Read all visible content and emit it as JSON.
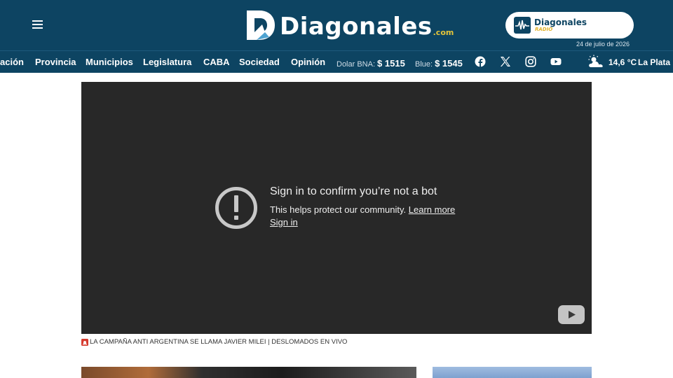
{
  "header": {
    "logo_text": "Diagonales",
    "logo_suffix": ".com",
    "radio_name": "Diagonales",
    "radio_sub": "RADIO",
    "date": "24 de julio de 2026"
  },
  "nav": {
    "items": [
      "ación",
      "Provincia",
      "Municipios",
      "Legislatura",
      "CABA",
      "Sociedad",
      "Opinión"
    ],
    "rates": [
      {
        "label": "Dolar BNA:",
        "value": "$ 1515"
      },
      {
        "label": "Blue:",
        "value": "$ 1545"
      }
    ],
    "social_icons": [
      "facebook-icon",
      "x-icon",
      "instagram-icon",
      "youtube-icon"
    ],
    "weather": {
      "icon": "partly-cloudy-icon",
      "temp": "14,6 °C",
      "city": "La Plata |"
    }
  },
  "video": {
    "title": "Sign in to confirm you’re not a bot",
    "body": "This helps protect our community.",
    "learn_more": "Learn more",
    "sign_in": "Sign in"
  },
  "caption": {
    "icon": "siren-icon",
    "text": "LA CAMPAÑA ANTI ARGENTINA SE LLAMA JAVIER MILEI | DESLOMADOS EN VIVO"
  },
  "colors": {
    "header_bg": "#0d4462",
    "accent_yellow": "#e3c43a",
    "video_bg": "#282828"
  }
}
